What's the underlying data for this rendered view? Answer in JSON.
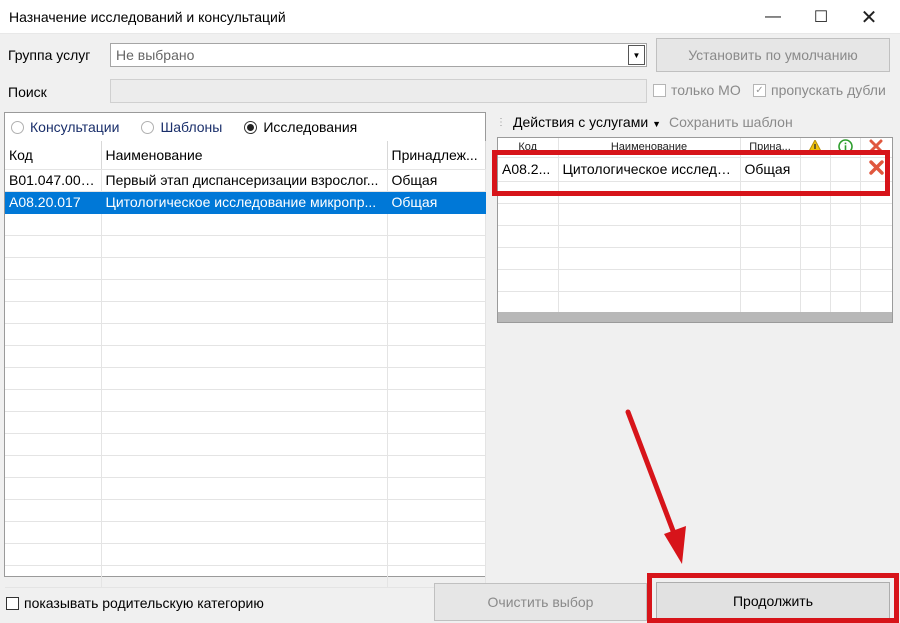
{
  "window": {
    "title": "Назначение исследований и консультаций",
    "min_glyph": "—",
    "max_glyph": "☐",
    "close_glyph": "✕"
  },
  "filters": {
    "group_label": "Группа услуг",
    "group_value": "Не выбрано",
    "default_button": "Установить по умолчанию",
    "search_label": "Поиск",
    "search_value": "",
    "only_mo_label": "только МО",
    "only_mo_checked": false,
    "skip_duplicates_label": "пропускать дубли",
    "skip_duplicates_checked": true
  },
  "tabs": {
    "consultations": "Консультации",
    "templates": "Шаблоны",
    "studies": "Исследования",
    "selected": "studies"
  },
  "left_grid": {
    "columns": [
      "Код",
      "Наименование",
      "Принадлеж..."
    ],
    "rows": [
      {
        "code": "B01.047.001...",
        "name": "Первый этап диспансеризации взрослог...",
        "owner": "Общая",
        "selected": false
      },
      {
        "code": "A08.20.017",
        "name": "Цитологическое исследование микропр...",
        "owner": "Общая",
        "selected": true
      }
    ]
  },
  "right_toolbar": {
    "actions_menu": "Действия с услугами",
    "save_template": "Сохранить шаблон"
  },
  "right_grid": {
    "columns": [
      "Код",
      "Наименование",
      "Прина...",
      "warning-icon",
      "info-icon",
      "delete-icon"
    ],
    "rows": [
      {
        "code": "A08.2...",
        "name": "Цитологическое исследо...",
        "owner": "Общая"
      }
    ]
  },
  "bottom": {
    "show_parent_label": "показывать родительскую категорию",
    "show_parent_checked": false,
    "clear_button": "Очистить выбор",
    "continue_button": "Продолжить"
  },
  "colors": {
    "selection": "#0078d7",
    "annotation": "#d7141a",
    "disabled_text": "#8a8a8a"
  }
}
